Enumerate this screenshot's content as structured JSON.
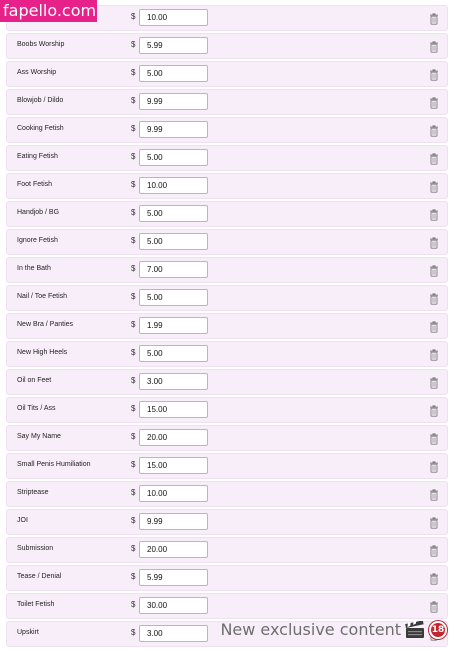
{
  "watermark": {
    "logo_text": "fapello.com",
    "caption": "New exclusive content",
    "badge": "18"
  },
  "currency_symbol": "$",
  "icons": {
    "delete": "trash-icon",
    "clapper": "clapperboard-icon"
  },
  "services": [
    {
      "label": "",
      "price": "10.00"
    },
    {
      "label": "Boobs Worship",
      "price": "5.99"
    },
    {
      "label": "Ass Worship",
      "price": "5.00"
    },
    {
      "label": "Blowjob / Dildo",
      "price": "9.99"
    },
    {
      "label": "Cooking Fetish",
      "price": "9.99"
    },
    {
      "label": "Eating Fetish",
      "price": "5.00"
    },
    {
      "label": "Foot Fetish",
      "price": "10.00"
    },
    {
      "label": "Handjob / BG",
      "price": "5.00"
    },
    {
      "label": "Ignore Fetish",
      "price": "5.00"
    },
    {
      "label": "In the Bath",
      "price": "7.00"
    },
    {
      "label": "Nail / Toe Fetish",
      "price": "5.00"
    },
    {
      "label": "New Bra / Panties",
      "price": "1.99"
    },
    {
      "label": "New High Heels",
      "price": "5.00"
    },
    {
      "label": "Oil on Feet",
      "price": "3.00"
    },
    {
      "label": "Oil Tits / Ass",
      "price": "15.00"
    },
    {
      "label": "Say My Name",
      "price": "20.00"
    },
    {
      "label": "Small Penis Humiliation",
      "price": "15.00"
    },
    {
      "label": "Striptease",
      "price": "10.00"
    },
    {
      "label": "JOI",
      "price": "9.99"
    },
    {
      "label": "Submission",
      "price": "20.00"
    },
    {
      "label": "Tease / Denial",
      "price": "5.99"
    },
    {
      "label": "Toilet Fetish",
      "price": "30.00"
    },
    {
      "label": "Upskirt",
      "price": "3.00"
    }
  ]
}
